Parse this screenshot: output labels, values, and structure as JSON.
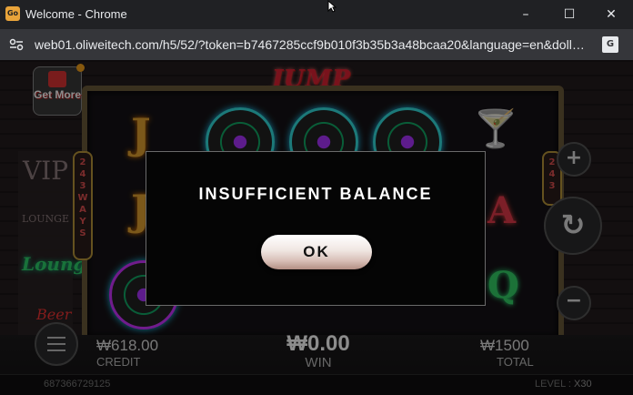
{
  "window": {
    "title": "Welcome - Chrome",
    "app_icon_text": "Go",
    "controls": {
      "minimize": "–",
      "maximize": "☐",
      "close": "✕"
    }
  },
  "address_bar": {
    "url": "web01.oliweitech.com/h5/52/?token=b7467285ccf9b010f3b35b3a48bcaa20&language=en&doll…",
    "translate_icon_text": "G"
  },
  "game": {
    "title_logo": "JUMP HIGH",
    "get_more_label": "Get More",
    "ways_text": [
      "2",
      "4",
      "3",
      "W",
      "A",
      "Y",
      "S"
    ],
    "ways_text_right": [
      "2",
      "4",
      "3"
    ],
    "decor": {
      "vip": "VIP",
      "lounge": "LOUNGE",
      "lounge_neon": "Lounge",
      "beer_neon": "Beer"
    },
    "credit": {
      "value": "₩618.00",
      "label": "CREDIT"
    },
    "win": {
      "value": "₩0.00",
      "label": "WIN"
    },
    "total": {
      "value": "₩1500",
      "label": "TOTAL"
    },
    "player_id": "687366729125",
    "level": {
      "label": "LEVEL :",
      "value": "X30"
    },
    "controls": {
      "plus": "+",
      "minus": "−",
      "spin": "↻"
    }
  },
  "reels": {
    "row1": [
      "J",
      "record",
      "record",
      "record",
      "cocktail"
    ],
    "row2": [
      "J",
      "",
      "",
      "",
      "A"
    ],
    "row3": [
      "record",
      "",
      "",
      "",
      "Q"
    ]
  },
  "modal": {
    "message": "INSUFFICIENT BALANCE",
    "ok_label": "OK"
  }
}
